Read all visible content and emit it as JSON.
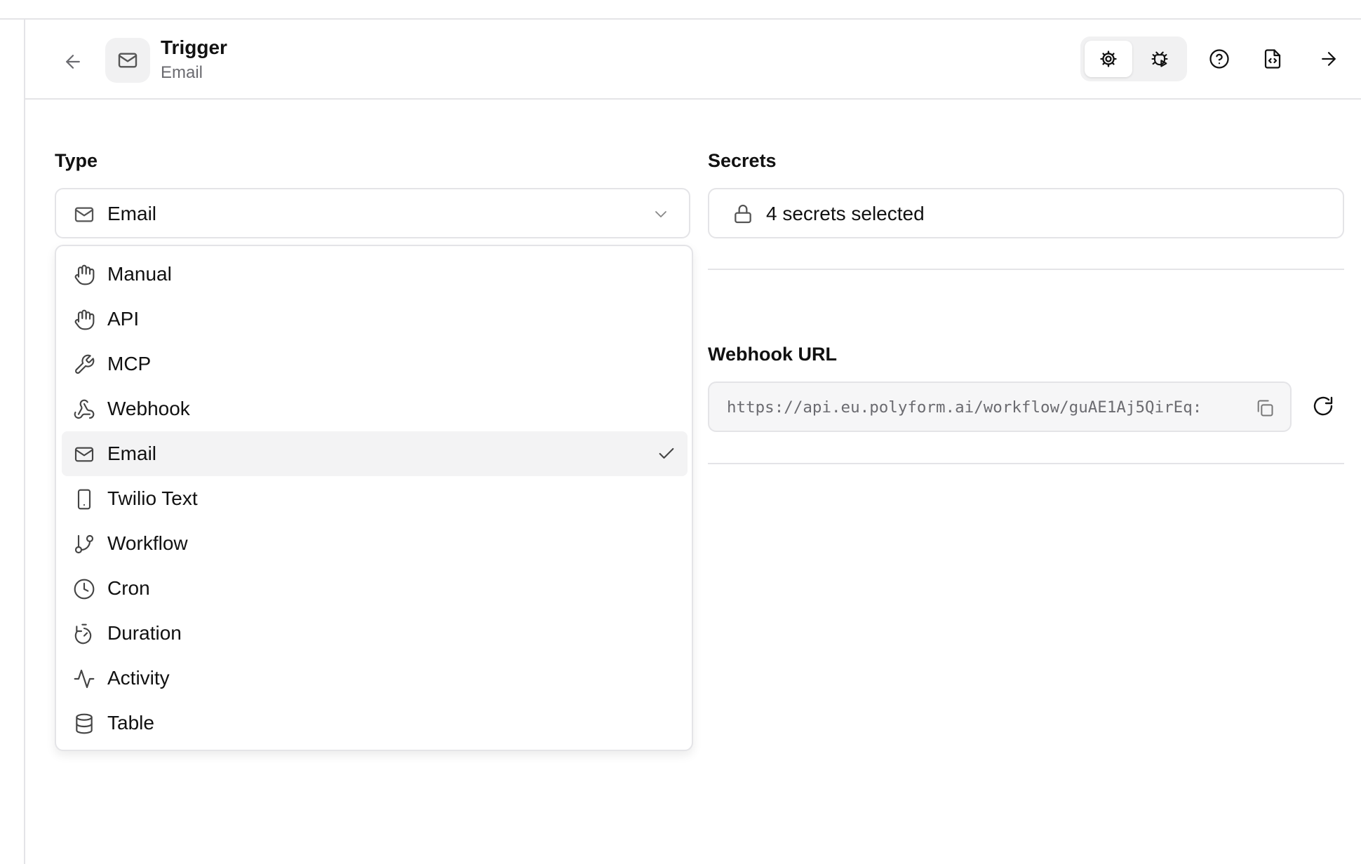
{
  "header": {
    "title": "Trigger",
    "subtitle": "Email",
    "node_icon": "mail-icon",
    "toolbar_icons": [
      "back-arrow-icon",
      "gear-icon",
      "bug-icon",
      "help-circle-icon",
      "code-file-icon",
      "forward-arrow-icon"
    ]
  },
  "type_field": {
    "label": "Type",
    "value": "Email",
    "icon": "mail-icon"
  },
  "secrets_field": {
    "label": "Secrets",
    "value": "4 secrets selected",
    "icon": "lock-icon"
  },
  "webhook": {
    "label": "Webhook URL",
    "value": "https://api.eu.polyform.ai/workflow/guAE1Aj5QirEq:"
  },
  "dropdown": {
    "options": [
      {
        "label": "Manual",
        "icon": "hand-icon"
      },
      {
        "label": "API",
        "icon": "hand-icon"
      },
      {
        "label": "MCP",
        "icon": "wrench-icon"
      },
      {
        "label": "Webhook",
        "icon": "webhook-icon"
      },
      {
        "label": "Email",
        "icon": "mail-icon",
        "selected": true
      },
      {
        "label": "Twilio Text",
        "icon": "phone-icon"
      },
      {
        "label": "Workflow",
        "icon": "git-branch-icon"
      },
      {
        "label": "Cron",
        "icon": "clock-icon"
      },
      {
        "label": "Duration",
        "icon": "timer-icon"
      },
      {
        "label": "Activity",
        "icon": "activity-icon"
      },
      {
        "label": "Table",
        "icon": "database-icon"
      }
    ]
  },
  "colors": {
    "border": "#e4e4e7",
    "muted_text": "#6b6b70",
    "selected_bg": "#f3f3f4",
    "chip_bg": "#f1f1f2"
  }
}
